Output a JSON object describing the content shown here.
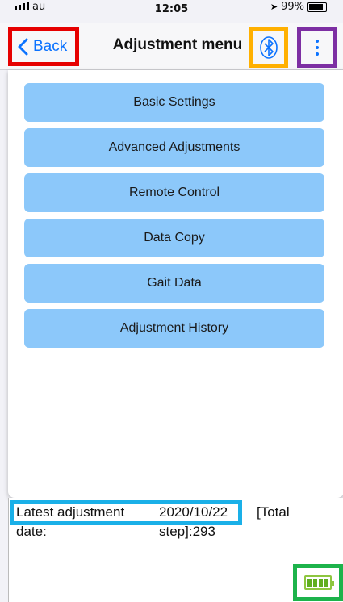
{
  "status_bar": {
    "carrier": "au",
    "time": "12:05",
    "battery": "99%"
  },
  "nav": {
    "back_label": "Back",
    "title": "Adjustment menu",
    "bluetooth_icon": "bluetooth-icon",
    "more_icon": "more-vertical-icon"
  },
  "menu": {
    "items": [
      {
        "label": "Basic Settings"
      },
      {
        "label": "Advanced Adjustments"
      },
      {
        "label": "Remote Control"
      },
      {
        "label": "Data Copy"
      },
      {
        "label": "Gait Data"
      },
      {
        "label": "Adjustment History"
      }
    ]
  },
  "info": {
    "latest_label_line1": "Latest adjustment",
    "latest_label_line2": "date:",
    "date_line1": "2020/10/22",
    "date_line2": "step]:293",
    "total_label": "[Total"
  },
  "colors": {
    "accent": "#0a72ff",
    "menu_button": "#8cc8fa"
  }
}
